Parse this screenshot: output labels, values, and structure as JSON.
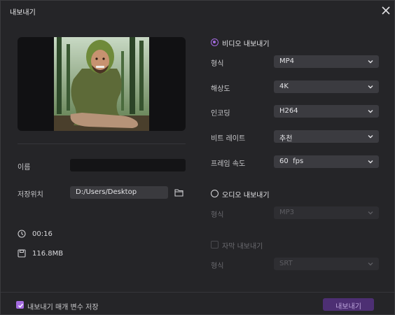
{
  "window": {
    "title": "내보내기"
  },
  "left": {
    "name_label": "이름",
    "name_value": "",
    "save_label": "저장위치",
    "save_path": "D:/Users/Desktop",
    "duration": "00:16",
    "file_size": "116.8MB"
  },
  "video": {
    "section_label": "비디오 내보내기",
    "selected": true,
    "format": {
      "label": "형식",
      "value": "MP4"
    },
    "resolution": {
      "label": "해상도",
      "value": "4K"
    },
    "encoding": {
      "label": "인코딩",
      "value": "H264"
    },
    "bitrate": {
      "label": "비트 레이트",
      "value": "추천"
    },
    "framerate": {
      "label": "프레임 속도",
      "value": "60  fps"
    }
  },
  "audio": {
    "section_label": "오디오 내보내기",
    "selected": false,
    "format": {
      "label": "형식",
      "value": "MP3"
    }
  },
  "subtitle": {
    "check_label": "자막 내보내기",
    "checked": false,
    "format": {
      "label": "형식",
      "value": "SRT"
    }
  },
  "footer": {
    "save_params_label": "내보내기 매개 변수 저장",
    "save_params_checked": true,
    "export_button": "내보내기"
  },
  "colors": {
    "accent": "#a46be0",
    "button": "#4d2f73",
    "background": "#252528"
  }
}
